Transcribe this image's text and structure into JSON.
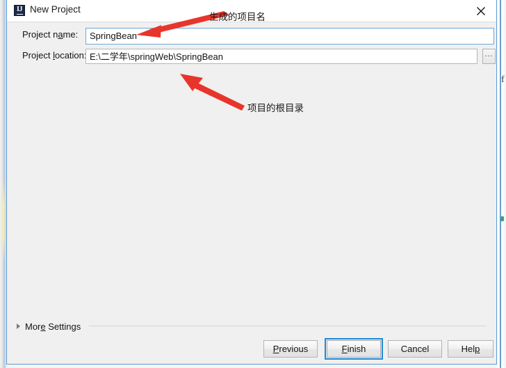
{
  "window": {
    "title": "New Project",
    "app_icon": "intellij-idea-icon",
    "close_icon": "close-icon",
    "accent_border": "#5b9bd5"
  },
  "form": {
    "project_name": {
      "label_prefix": "Project n",
      "label_mnemonic": "a",
      "label_suffix": "me:",
      "value": "SpringBean",
      "placeholder": ""
    },
    "project_location": {
      "label_prefix": "Project ",
      "label_mnemonic": "l",
      "label_suffix": "ocation:",
      "value": "E:\\二学年\\springWeb\\SpringBean",
      "placeholder": "",
      "browse_label": "..."
    }
  },
  "more_settings": {
    "label_prefix": "Mor",
    "label_mnemonic": "e",
    "label_suffix": " Settings",
    "expander_icon": "chevron-right-icon",
    "expanded": false
  },
  "footer": {
    "buttons": [
      {
        "id": "previous",
        "label_prefix": "",
        "label_mnemonic": "P",
        "label_suffix": "revious",
        "focused": false
      },
      {
        "id": "finish",
        "label_prefix": "",
        "label_mnemonic": "F",
        "label_suffix": "inish",
        "focused": true
      },
      {
        "id": "cancel",
        "label_prefix": "Cancel",
        "label_mnemonic": "",
        "label_suffix": "",
        "focused": false
      },
      {
        "id": "help",
        "label_prefix": "Hel",
        "label_mnemonic": "p",
        "label_suffix": "",
        "focused": false
      }
    ]
  },
  "annotations": {
    "arrow_color": "#e8352b",
    "items": [
      {
        "id": "annot-name",
        "text": "生成的项目名",
        "points_to": "project-name-input"
      },
      {
        "id": "annot-location",
        "text": "项目的根目录",
        "points_to": "project-location-input"
      }
    ]
  }
}
